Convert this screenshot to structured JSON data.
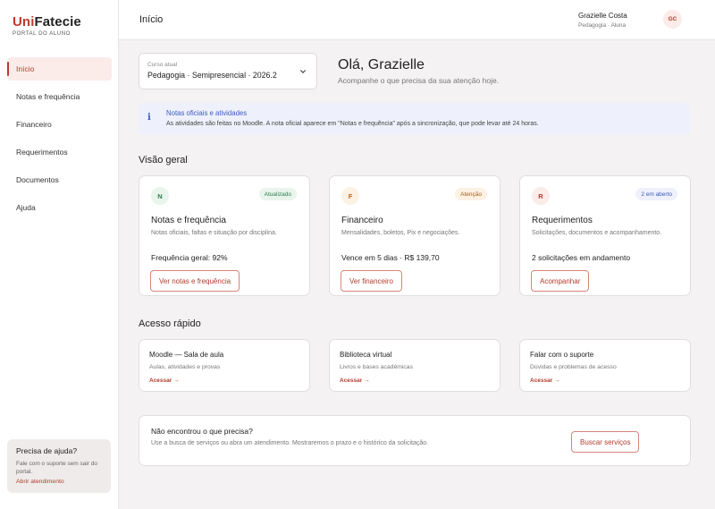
{
  "brand": {
    "name_accent": "Uni",
    "name_rest": "Fatecie",
    "subtitle": "PORTAL DO ALUNO"
  },
  "sidebar": {
    "items": [
      {
        "label": "Início",
        "active": true
      },
      {
        "label": "Notas e frequência"
      },
      {
        "label": "Financeiro"
      },
      {
        "label": "Requerimentos"
      },
      {
        "label": "Documentos"
      },
      {
        "label": "Ajuda"
      }
    ],
    "help": {
      "title": "Precisa de ajuda?",
      "text": "Fale com o suporte sem sair do portal.",
      "link": "Abrir atendimento"
    }
  },
  "header": {
    "title": "Início",
    "user_name": "Grazielle Costa",
    "user_role": "Pedagogia · Aluna",
    "avatar_initials": "GC"
  },
  "course": {
    "label": "Curso atual",
    "value": "Pedagogia · Semipresencial · 2026.2",
    "icon": "chevron-down-icon"
  },
  "greeting": {
    "title": "Olá, Grazielle",
    "subtitle": "Acompanhe o que precisa da sua atenção hoje."
  },
  "banner": {
    "icon": "info-icon",
    "title": "Notas oficiais e atividades",
    "text": "As atividades são feitas no Moodle. A nota oficial aparece em \"Notas e frequência\" após a sincronização, que pode levar até 24 horas."
  },
  "overview": {
    "title": "Visão geral",
    "cards": [
      {
        "letter": "N",
        "badge": "Atualizado",
        "title": "Notas e frequência",
        "desc": "Notas oficiais, faltas e situação por disciplina.",
        "stat": "Frequência geral: 92%",
        "button": "Ver notas e frequência",
        "letter_bg": "#e9f5ec",
        "letter_color": "#2e7d4f",
        "badge_bg": "#e9f5ec",
        "badge_color": "#2e7d4f"
      },
      {
        "letter": "F",
        "badge": "Atenção",
        "title": "Financeiro",
        "desc": "Mensalidades, boletos, Pix e negociações.",
        "stat": "Vence em 5 dias · R$ 139,70",
        "button": "Ver financeiro",
        "letter_bg": "#fdf1e4",
        "letter_color": "#b4621a",
        "badge_bg": "#fdf1e4",
        "badge_color": "#a65a16"
      },
      {
        "letter": "R",
        "badge": "2 em aberto",
        "title": "Requerimentos",
        "desc": "Solicitações, documentos e acompanhamento.",
        "stat": "2 solicitações em andamento",
        "button": "Acompanhar",
        "letter_bg": "#fbece9",
        "letter_color": "#b23b2b",
        "badge_bg": "#eef1fb",
        "badge_color": "#3c5ac2"
      }
    ]
  },
  "quick": {
    "title": "Acesso rápido",
    "cards": [
      {
        "title": "Moodle — Sala de aula",
        "desc": "Aulas, atividades e provas",
        "link": "Acessar →"
      },
      {
        "title": "Biblioteca virtual",
        "desc": "Livros e bases acadêmicas",
        "link": "Acessar →"
      },
      {
        "title": "Falar com o suporte",
        "desc": "Dúvidas e problemas de acesso",
        "link": "Acessar →"
      }
    ]
  },
  "notfound": {
    "title": "Não encontrou o que precisa?",
    "text": "Use a busca de serviços ou abra um atendimento. Mostraremos o prazo e o histórico da solicitação.",
    "button": "Buscar serviços"
  },
  "colors": {
    "accent": "#c0392b",
    "info": "#3c5ac2"
  }
}
